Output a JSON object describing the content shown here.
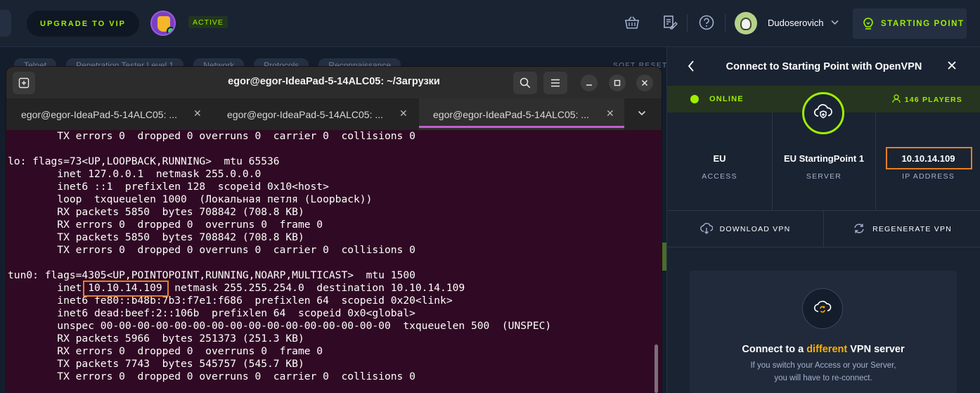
{
  "topbar": {
    "vip_label": "UPGRADE TO VIP",
    "active_label": "ACTIVE",
    "username": "Dudoserovich",
    "starting_point_label": "STARTING POINT"
  },
  "background": {
    "chips": [
      "Telnet",
      "Penetration Tester Level 1",
      "Network",
      "Protocols",
      "Reconnaissance"
    ],
    "soft_reset": "SOFT RESET"
  },
  "terminal": {
    "title": "egor@egor-IdeaPad-5-14ALC05: ~/Загрузки",
    "tabs": [
      {
        "label": "egor@egor-IdeaPad-5-14ALC05: ..."
      },
      {
        "label": "egor@egor-IdeaPad-5-14ALC05: ..."
      },
      {
        "label": "egor@egor-IdeaPad-5-14ALC05: ..."
      }
    ],
    "lines": [
      "        TX errors 0  dropped 0 overruns 0  carrier 0  collisions 0",
      "",
      "lo: flags=73<UP,LOOPBACK,RUNNING>  mtu 65536",
      "        inet 127.0.0.1  netmask 255.0.0.0",
      "        inet6 ::1  prefixlen 128  scopeid 0x10<host>",
      "        loop  txqueuelen 1000  (Локальная петля (Loopback))",
      "        RX packets 5850  bytes 708842 (708.8 KB)",
      "        RX errors 0  dropped 0  overruns 0  frame 0",
      "        TX packets 5850  bytes 708842 (708.8 KB)",
      "        TX errors 0  dropped 0 overruns 0  carrier 0  collisions 0",
      "",
      "tun0: flags=4305<UP,POINTOPOINT,RUNNING,NOARP,MULTICAST>  mtu 1500",
      "        inet 10.10.14.109  netmask 255.255.254.0  destination 10.10.14.109",
      "        inet6 fe80::b48b:7b3:f7e1:f686  prefixlen 64  scopeid 0x20<link>",
      "        inet6 dead:beef:2::106b  prefixlen 64  scopeid 0x0<global>",
      "        unspec 00-00-00-00-00-00-00-00-00-00-00-00-00-00-00-00  txqueuelen 500  (UNSPEC)",
      "        RX packets 5966  bytes 251373 (251.3 KB)",
      "        RX errors 0  dropped 0  overruns 0  frame 0",
      "        TX packets 7743  bytes 545757 (545.7 KB)",
      "        TX errors 0  dropped 0 overruns 0  carrier 0  collisions 0"
    ]
  },
  "panel": {
    "title": "Connect to Starting Point with OpenVPN",
    "status": "ONLINE",
    "players": "146 PLAYERS",
    "access_value": "EU",
    "access_label": "ACCESS",
    "server_value": "EU StartingPoint 1",
    "server_label": "SERVER",
    "ip_value": "10.10.14.109",
    "ip_label": "IP ADDRESS",
    "download_label": "DOWNLOAD VPN",
    "regenerate_label": "REGENERATE VPN",
    "switch_title_pre": "Connect to a",
    "switch_title_hl": "different",
    "switch_title_post": "VPN server",
    "switch_desc_1": "If you switch your Access or your Server,",
    "switch_desc_2": "you will have to re-connect."
  },
  "colors": {
    "accent_green": "#9fef00",
    "highlight_orange": "#e67e22",
    "terminal_bg": "#300a24",
    "active_tab_underline": "#c061cb"
  }
}
